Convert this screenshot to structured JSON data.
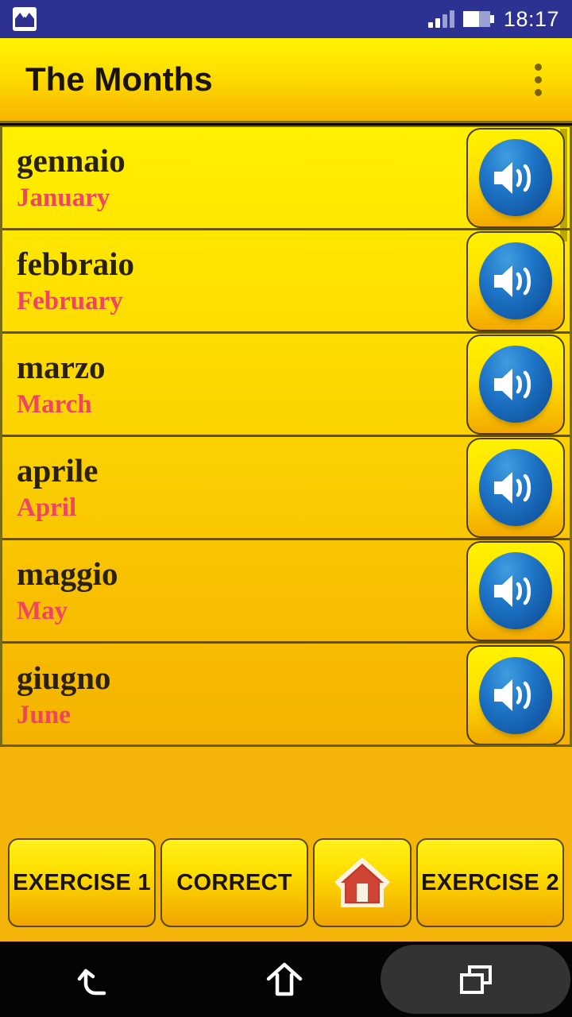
{
  "status_bar": {
    "notification_icon": "screenshot-image-icon",
    "signal_icon": "signal-bars-icon",
    "battery_icon": "battery-icon",
    "time": "18:17",
    "background_color": "#2c3192"
  },
  "action_bar": {
    "title": "The Months",
    "overflow_icon": "overflow-menu-icon",
    "gradient_from": "#fff200",
    "gradient_to": "#f8b500",
    "title_color": "#1a1408"
  },
  "list": {
    "native_color": "#2a2109",
    "translation_color": "#ef4464",
    "speaker_icon": "speaker-icon",
    "items": [
      {
        "native": "gennaio",
        "translation": "January"
      },
      {
        "native": "febbraio",
        "translation": "February"
      },
      {
        "native": "marzo",
        "translation": "March"
      },
      {
        "native": "aprile",
        "translation": "April"
      },
      {
        "native": "maggio",
        "translation": "May"
      },
      {
        "native": "giugno",
        "translation": "June"
      }
    ]
  },
  "bottom_bar": {
    "background_color": "#f5b40a",
    "buttons": [
      {
        "label": "EXERCISE 1",
        "kind": "text"
      },
      {
        "label": "CORRECT",
        "kind": "text"
      },
      {
        "label": "",
        "kind": "home-icon"
      },
      {
        "label": "EXERCISE 2",
        "kind": "text"
      }
    ]
  },
  "nav_bar": {
    "back_icon": "back-arrow-icon",
    "home_icon": "home-outline-icon",
    "recents_icon": "recents-squares-icon",
    "background_color": "#040404"
  }
}
